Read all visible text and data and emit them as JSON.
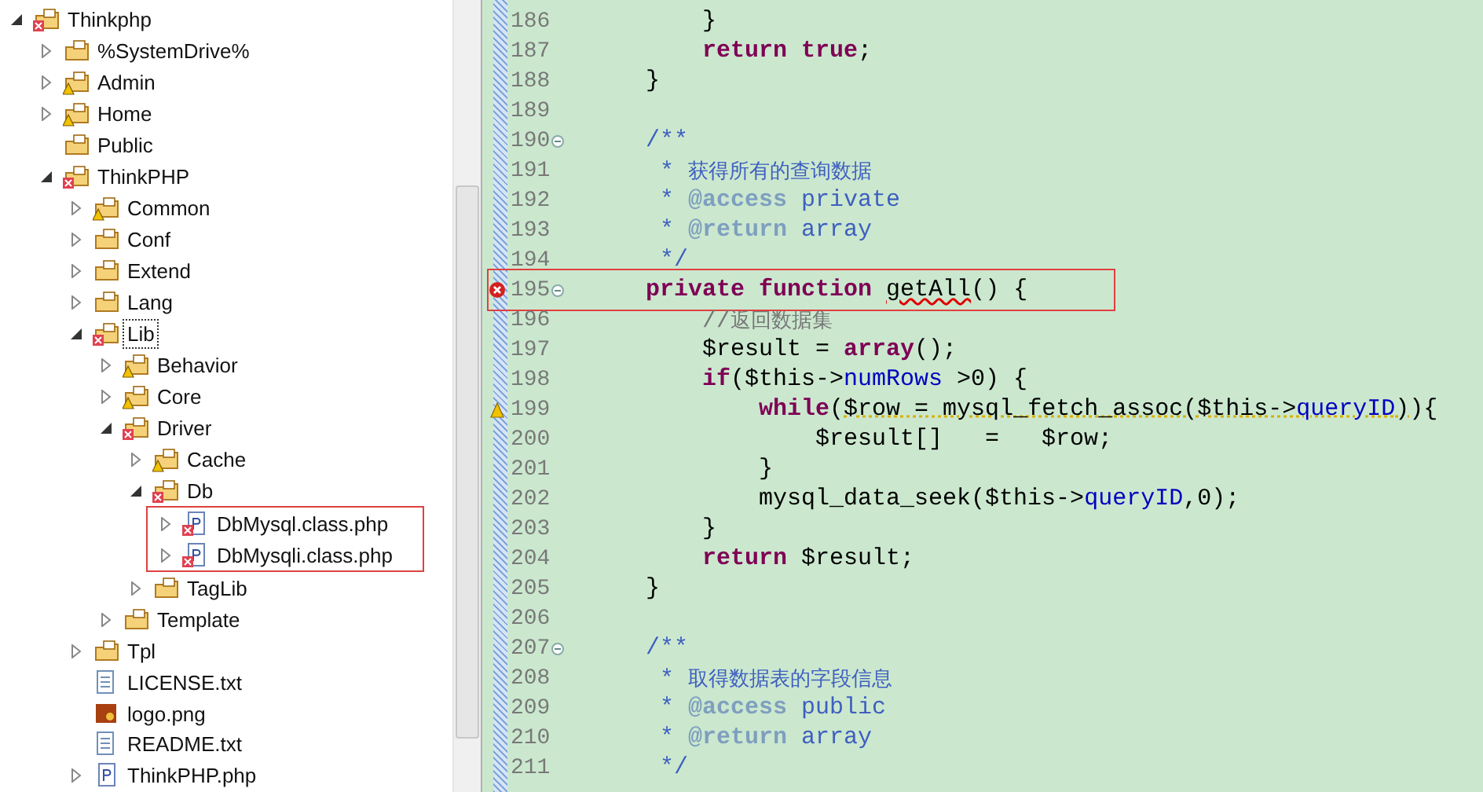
{
  "tree": [
    {
      "label": "Thinkphp",
      "kind": "project",
      "error": true,
      "warning": false,
      "expanded": true,
      "selected": false,
      "children": [
        {
          "label": "%SystemDrive%",
          "kind": "folder",
          "error": false,
          "warning": false,
          "expanded": false,
          "selected": false
        },
        {
          "label": "Admin",
          "kind": "folder",
          "error": false,
          "warning": true,
          "expanded": false,
          "selected": false
        },
        {
          "label": "Home",
          "kind": "folder",
          "error": false,
          "warning": true,
          "expanded": false,
          "selected": false
        },
        {
          "label": "Public",
          "kind": "folder",
          "error": false,
          "warning": false,
          "selected": false
        },
        {
          "label": "ThinkPHP",
          "kind": "folder",
          "error": true,
          "warning": false,
          "expanded": true,
          "selected": false,
          "children": [
            {
              "label": "Common",
              "kind": "folder",
              "error": false,
              "warning": true,
              "expanded": false,
              "selected": false
            },
            {
              "label": "Conf",
              "kind": "folder",
              "error": false,
              "warning": false,
              "expanded": false,
              "selected": false
            },
            {
              "label": "Extend",
              "kind": "folder",
              "error": false,
              "warning": false,
              "expanded": false,
              "selected": false
            },
            {
              "label": "Lang",
              "kind": "folder",
              "error": false,
              "warning": false,
              "expanded": false,
              "selected": false
            },
            {
              "label": "Lib",
              "kind": "folder",
              "error": true,
              "warning": false,
              "expanded": true,
              "selected": true,
              "children": [
                {
                  "label": "Behavior",
                  "kind": "folder",
                  "error": false,
                  "warning": true,
                  "expanded": false,
                  "selected": false
                },
                {
                  "label": "Core",
                  "kind": "folder",
                  "error": false,
                  "warning": true,
                  "expanded": false,
                  "selected": false
                },
                {
                  "label": "Driver",
                  "kind": "folder",
                  "error": true,
                  "warning": false,
                  "expanded": true,
                  "selected": false,
                  "children": [
                    {
                      "label": "Cache",
                      "kind": "folder",
                      "error": false,
                      "warning": true,
                      "expanded": false,
                      "selected": false
                    },
                    {
                      "label": "Db",
                      "kind": "folder",
                      "error": true,
                      "warning": false,
                      "expanded": true,
                      "selected": false,
                      "children": [
                        {
                          "label": "DbMysql.class.php",
                          "kind": "php",
                          "error": true,
                          "warning": false,
                          "expanded": false,
                          "selected": false,
                          "highlighted": true
                        },
                        {
                          "label": "DbMysqli.class.php",
                          "kind": "php",
                          "error": true,
                          "warning": false,
                          "expanded": false,
                          "selected": false,
                          "highlighted": true
                        }
                      ]
                    },
                    {
                      "label": "TagLib",
                      "kind": "folder",
                      "error": false,
                      "warning": false,
                      "expanded": false,
                      "selected": false
                    }
                  ]
                },
                {
                  "label": "Template",
                  "kind": "folder",
                  "error": false,
                  "warning": false,
                  "expanded": false,
                  "selected": false
                }
              ]
            },
            {
              "label": "Tpl",
              "kind": "folder",
              "error": false,
              "warning": false,
              "expanded": false,
              "selected": false
            },
            {
              "label": "LICENSE.txt",
              "kind": "text",
              "error": false,
              "warning": false,
              "selected": false
            },
            {
              "label": "logo.png",
              "kind": "image",
              "error": false,
              "warning": false,
              "selected": false
            },
            {
              "label": "README.txt",
              "kind": "text",
              "error": false,
              "warning": false,
              "selected": false
            },
            {
              "label": "ThinkPHP.php",
              "kind": "php",
              "error": false,
              "warning": false,
              "expanded": false,
              "selected": false
            }
          ]
        }
      ]
    }
  ],
  "editor": {
    "lines": [
      {
        "number": "186",
        "tokens": [
          {
            "kind": "plain",
            "text": "        }"
          }
        ]
      },
      {
        "number": "187",
        "tokens": [
          {
            "kind": "kw",
            "text": "        return"
          },
          {
            "kind": "kw",
            "text": " true"
          },
          {
            "kind": "plain",
            "text": ";"
          }
        ]
      },
      {
        "number": "188",
        "tokens": [
          {
            "kind": "plain",
            "text": "    }"
          }
        ]
      },
      {
        "number": "189"
      },
      {
        "number": "190",
        "expanded": true,
        "tokens": [
          {
            "kind": "doc",
            "text": "    /**"
          }
        ]
      },
      {
        "number": "191",
        "tokens": [
          {
            "kind": "doc",
            "text": "     * "
          },
          {
            "kind": "doc_cjk",
            "text": "获得所有的查询数据"
          }
        ]
      },
      {
        "number": "192",
        "tokens": [
          {
            "kind": "doc",
            "text": "     * "
          },
          {
            "kind": "doctag",
            "text": "@access"
          },
          {
            "kind": "doc",
            "text": " private"
          }
        ]
      },
      {
        "number": "193",
        "tokens": [
          {
            "kind": "doc",
            "text": "     * "
          },
          {
            "kind": "doctag",
            "text": "@return"
          },
          {
            "kind": "doc",
            "text": " array"
          }
        ]
      },
      {
        "number": "194",
        "tokens": [
          {
            "kind": "doc",
            "text": "     */"
          }
        ]
      },
      {
        "number": "195",
        "expanded": true,
        "error": true,
        "highlighted": true,
        "tokens": [
          {
            "kind": "kw",
            "text": "    private"
          },
          {
            "kind": "kw",
            "text": " function "
          },
          {
            "kind": "error",
            "text": "getAll"
          },
          {
            "kind": "plain",
            "text": "() {"
          }
        ]
      },
      {
        "number": "196",
        "tokens": [
          {
            "kind": "comment",
            "text": "        //"
          },
          {
            "kind": "comment_cjk",
            "text": "返回数据集"
          }
        ]
      },
      {
        "number": "197",
        "tokens": [
          {
            "kind": "plain",
            "text": "        $result = "
          },
          {
            "kind": "kw",
            "text": "array"
          },
          {
            "kind": "plain",
            "text": "();"
          }
        ]
      },
      {
        "number": "198",
        "tokens": [
          {
            "kind": "kw",
            "text": "        if"
          },
          {
            "kind": "plain",
            "text": "($this->"
          },
          {
            "kind": "field",
            "text": "numRows"
          },
          {
            "kind": "plain",
            "text": " >0) {"
          }
        ]
      },
      {
        "number": "199",
        "warning": true,
        "tokens": [
          {
            "kind": "kw",
            "text": "            while"
          },
          {
            "kind": "plain",
            "text": "("
          },
          {
            "kind": "warn",
            "text": "$row = mysql_fetch_assoc($this->"
          },
          {
            "kind": "warnfield",
            "text": "queryID"
          },
          {
            "kind": "warn",
            "text": ")"
          },
          {
            "kind": "plain",
            "text": "){"
          }
        ]
      },
      {
        "number": "200",
        "tokens": [
          {
            "kind": "plain",
            "text": "                $result[]   =   $row;"
          }
        ]
      },
      {
        "number": "201",
        "tokens": [
          {
            "kind": "plain",
            "text": "            }"
          }
        ]
      },
      {
        "number": "202",
        "tokens": [
          {
            "kind": "plain",
            "text": "            mysql_data_seek($this->"
          },
          {
            "kind": "field",
            "text": "queryID"
          },
          {
            "kind": "plain",
            "text": ",0);"
          }
        ]
      },
      {
        "number": "203",
        "tokens": [
          {
            "kind": "plain",
            "text": "        }"
          }
        ]
      },
      {
        "number": "204",
        "tokens": [
          {
            "kind": "kw",
            "text": "        return"
          },
          {
            "kind": "plain",
            "text": " $result;"
          }
        ]
      },
      {
        "number": "205",
        "tokens": [
          {
            "kind": "plain",
            "text": "    }"
          }
        ]
      },
      {
        "number": "206"
      },
      {
        "number": "207",
        "expanded": true,
        "tokens": [
          {
            "kind": "doc",
            "text": "    /**"
          }
        ]
      },
      {
        "number": "208",
        "tokens": [
          {
            "kind": "doc",
            "text": "     * "
          },
          {
            "kind": "doc_cjk",
            "text": "取得数据表的字段信息"
          }
        ]
      },
      {
        "number": "209",
        "tokens": [
          {
            "kind": "doc",
            "text": "     * "
          },
          {
            "kind": "doctag",
            "text": "@access"
          },
          {
            "kind": "doc",
            "text": " public"
          }
        ]
      },
      {
        "number": "210",
        "tokens": [
          {
            "kind": "doc",
            "text": "     * "
          },
          {
            "kind": "doctag",
            "text": "@return"
          },
          {
            "kind": "doc",
            "text": " array"
          }
        ]
      },
      {
        "number": "211",
        "tokens": [
          {
            "kind": "doc",
            "text": "     */"
          }
        ]
      }
    ]
  }
}
